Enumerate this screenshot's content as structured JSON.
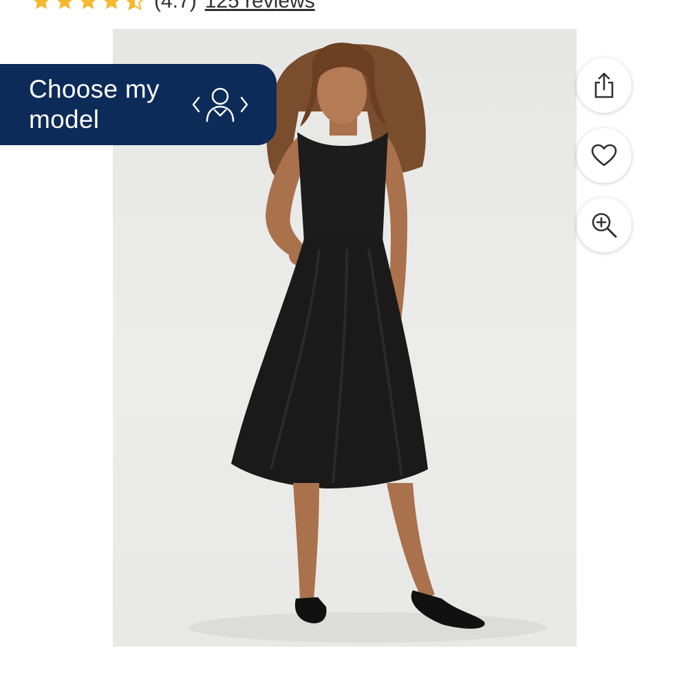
{
  "rating": {
    "value_text": "(4.7)",
    "reviews_text": "125 reviews",
    "stars": 4.7,
    "star_color": "#f5b82e"
  },
  "choose_model": {
    "label": "Choose my model",
    "icon": "person-icon",
    "background_color": "#0d2b59"
  },
  "actions": {
    "share_icon": "share-icon",
    "favorite_icon": "heart-icon",
    "zoom_icon": "zoom-in-icon"
  },
  "product_image": {
    "subject": "model-wearing-black-sleeveless-midi-dress"
  }
}
